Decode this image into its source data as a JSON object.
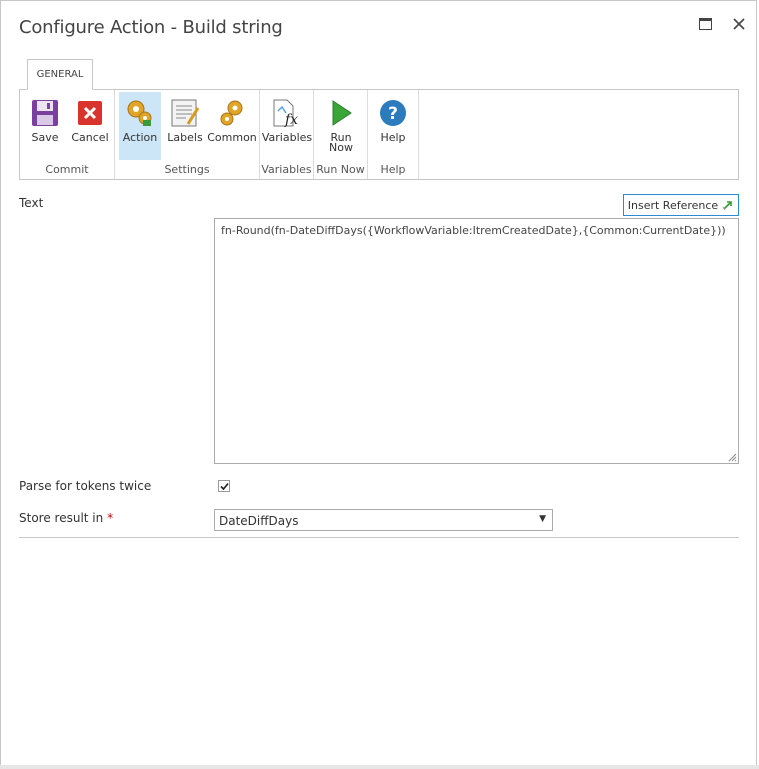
{
  "dialog": {
    "title": "Configure Action - Build string"
  },
  "ribbon": {
    "tab": "GENERAL",
    "groups": [
      {
        "label": "Commit",
        "buttons": [
          {
            "label": "Save",
            "icon": "save-icon"
          },
          {
            "label": "Cancel",
            "icon": "cancel-icon"
          }
        ]
      },
      {
        "label": "Settings",
        "buttons": [
          {
            "label": "Action",
            "icon": "action-gears-icon"
          },
          {
            "label": "Labels",
            "icon": "labels-icon"
          },
          {
            "label": "Common",
            "icon": "common-gears-icon"
          }
        ]
      },
      {
        "label": "Variables",
        "buttons": [
          {
            "label": "Variables",
            "icon": "variables-fx-icon"
          }
        ]
      },
      {
        "label": "Run Now",
        "buttons": [
          {
            "label": "Run Now",
            "icon": "run-play-icon"
          }
        ]
      },
      {
        "label": "Help",
        "buttons": [
          {
            "label": "Help",
            "icon": "help-icon"
          }
        ]
      }
    ]
  },
  "form": {
    "text_label": "Text",
    "insert_reference": "Insert Reference",
    "text_value": "fn-Round(fn-DateDiffDays({WorkflowVariable:ItremCreatedDate},{Common:CurrentDate}))",
    "parse_label": "Parse for tokens twice",
    "parse_checked": true,
    "store_label": "Store result in",
    "required_mark": "*",
    "store_value": "DateDiffDays"
  },
  "colors": {
    "accent": "#2a8dd4",
    "active_button_bg": "#cde6f7",
    "border": "#c6c6c6"
  }
}
